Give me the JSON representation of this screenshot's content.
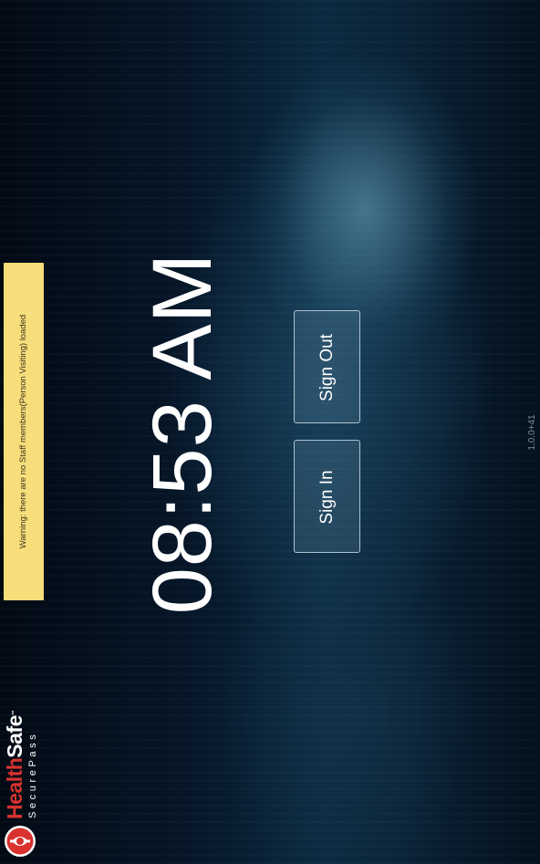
{
  "warning": {
    "text": "Warning: there are no Staff members(Person Visiting) loaded"
  },
  "clock": {
    "time": "08:53 AM"
  },
  "buttons": {
    "sign_in": "Sign In",
    "sign_out": "Sign Out"
  },
  "version": "1.0.0+41",
  "logo": {
    "health": "Health",
    "safe": "Safe",
    "tm": "™",
    "tagline": "SecurePass"
  },
  "colors": {
    "warning_bg": "#f7de7a",
    "brand_red": "#d9322f"
  },
  "icons": {
    "logo_mark": "healthsafe-shield-icon"
  }
}
